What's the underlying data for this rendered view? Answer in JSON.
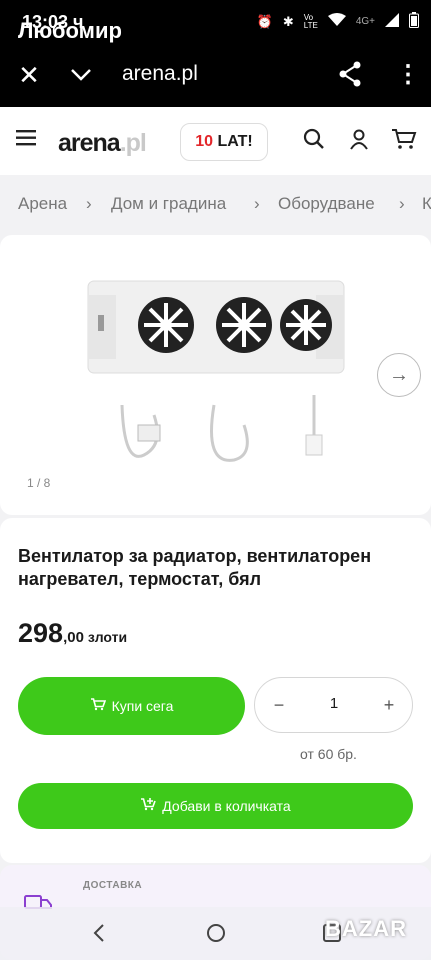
{
  "status_bar": {
    "time": "13:03 ч",
    "contact_name": "Любомир",
    "signal_text": "4G+",
    "icons": [
      "alarm-icon",
      "bluetooth-icon",
      "volte-icon",
      "wifi-icon",
      "signal-icon",
      "battery-icon"
    ]
  },
  "browser": {
    "url": "arena.pl",
    "icons": [
      "close-icon",
      "chevron-down-icon",
      "share-icon",
      "more-vert-icon"
    ]
  },
  "site_header": {
    "logo_main": "arena",
    "logo_suffix": ".pl",
    "anniversary_number": "10",
    "anniversary_text": "LAT!",
    "icons": [
      "menu-icon",
      "search-icon",
      "user-icon",
      "cart-icon"
    ]
  },
  "breadcrumbs": [
    "Арена",
    "Дом и градина",
    "Оборудване",
    "К"
  ],
  "breadcrumb_separator": "›",
  "gallery": {
    "counter": "1 / 8",
    "next_icon": "arrow-right-icon"
  },
  "product": {
    "title": "Вентилатор за радиатор, вентилаторен нагревател, термостат, бял",
    "price_whole": "298",
    "price_decimal": ",00",
    "currency": "злоти"
  },
  "actions": {
    "buy_now_label": "Купи сега",
    "quantity_value": "1",
    "minus_symbol": "−",
    "plus_symbol": "+",
    "min_order": "от 60 бр.",
    "add_to_quantity_label": "Добави в количката"
  },
  "delivery": {
    "label": "ДОСТАВКА"
  },
  "watermark": "BAZAR",
  "colors": {
    "accent_green": "#3ec91a",
    "logo_red": "#e3262a",
    "delivery_bg": "#f6f2fb"
  }
}
